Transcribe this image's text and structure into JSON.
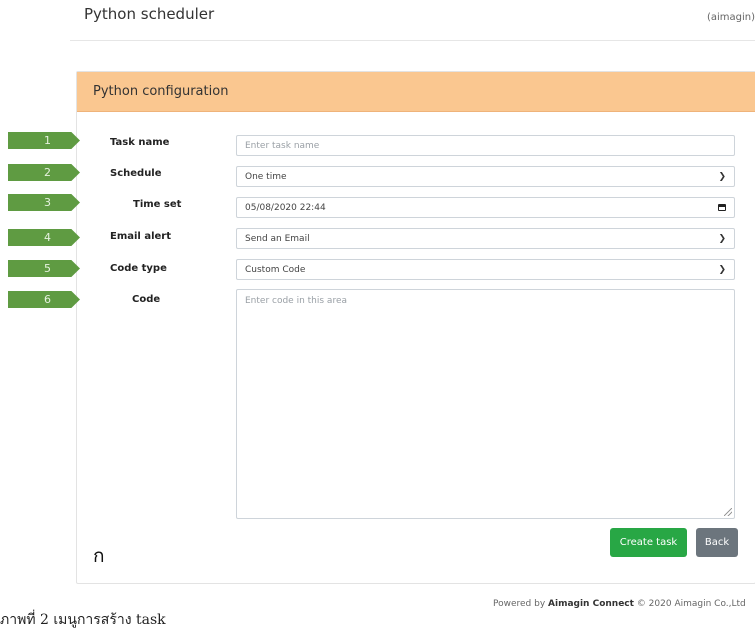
{
  "header": {
    "app_title": "Python scheduler",
    "user_label": "(aimagin)"
  },
  "card": {
    "title": "Python configuration"
  },
  "markers": [
    "1",
    "2",
    "3",
    "4",
    "5",
    "6"
  ],
  "form": {
    "task_name": {
      "label": "Task name",
      "placeholder": "Enter task name"
    },
    "schedule": {
      "label": "Schedule",
      "value": "One time"
    },
    "time_set": {
      "label": "Time set",
      "value": "05/08/2020 22:44"
    },
    "email_alert": {
      "label": "Email alert",
      "value": "Send an Email"
    },
    "code_type": {
      "label": "Code type",
      "value": "Custom Code"
    },
    "code": {
      "label": "Code",
      "placeholder": "Enter code in this area"
    }
  },
  "buttons": {
    "create": "Create task",
    "back": "Back"
  },
  "stray_glyph": "ก",
  "caption": "ภาพที่ 2 เมนูการสร้าง task",
  "footer": {
    "prefix": "Powered by ",
    "brand": "Aimagin Connect",
    "suffix": " © 2020 Aimagin Co.,Ltd"
  },
  "icons": {
    "select": "chevron-down-icon",
    "date": "calendar-icon"
  }
}
